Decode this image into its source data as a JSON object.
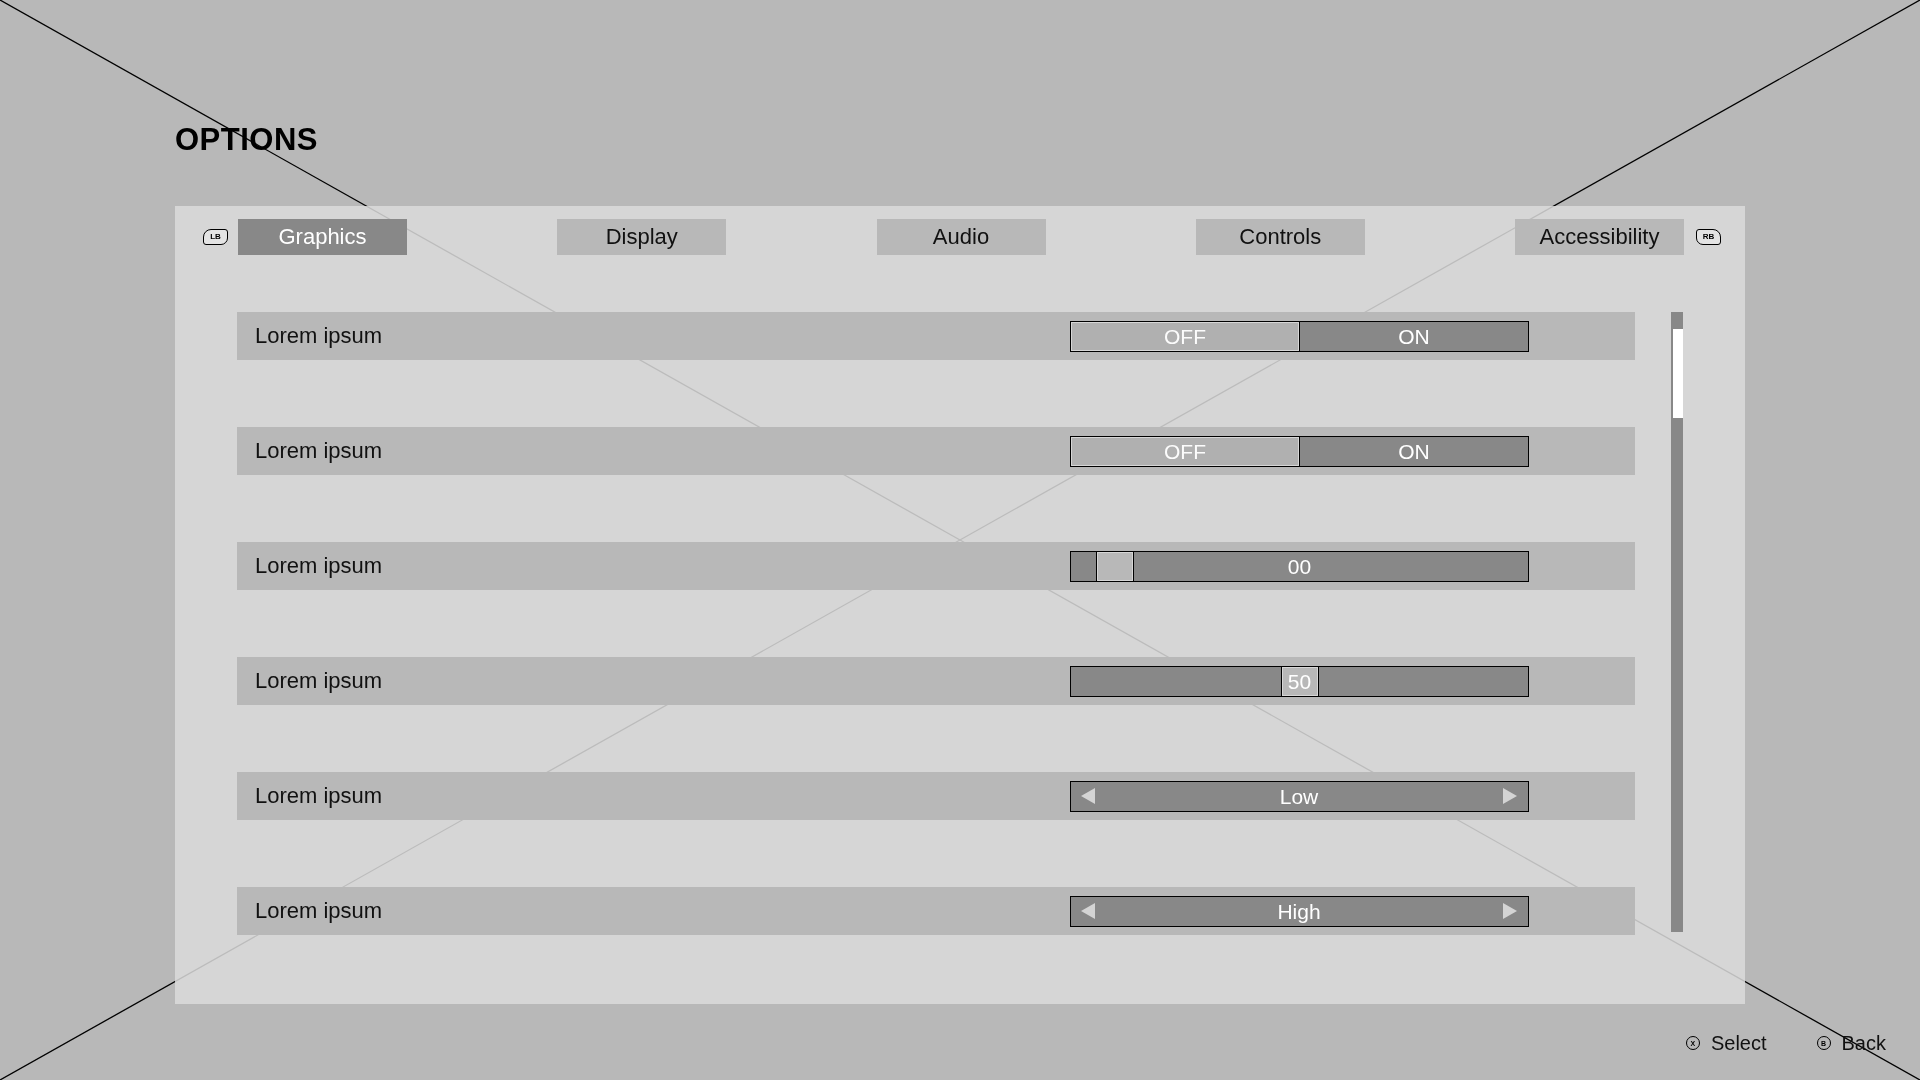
{
  "title": "OPTIONS",
  "tab_bar": {
    "prev_key": "LB",
    "next_key": "RB",
    "tabs": [
      {
        "label": "Graphics",
        "selected": true
      },
      {
        "label": "Display",
        "selected": false
      },
      {
        "label": "Audio",
        "selected": false
      },
      {
        "label": "Controls",
        "selected": false
      },
      {
        "label": "Accessibility",
        "selected": false
      }
    ]
  },
  "settings": [
    {
      "kind": "toggle",
      "label": "Lorem ipsum",
      "off_label": "OFF",
      "on_label": "ON",
      "on": true
    },
    {
      "kind": "toggle",
      "label": "Lorem ipsum",
      "off_label": "OFF",
      "on_label": "ON",
      "on": true
    },
    {
      "kind": "slider",
      "label": "Lorem ipsum",
      "level": 0.06,
      "reading": "00"
    },
    {
      "kind": "slider",
      "label": "Lorem ipsum",
      "level": 0.5,
      "reading": "50"
    },
    {
      "kind": "selector",
      "label": "Lorem ipsum",
      "value": "Low"
    },
    {
      "kind": "selector",
      "label": "Lorem ipsum",
      "value": "High"
    }
  ],
  "footer_hints": [
    {
      "key": "X",
      "label": "Select"
    },
    {
      "key": "B",
      "label": "Back"
    }
  ]
}
